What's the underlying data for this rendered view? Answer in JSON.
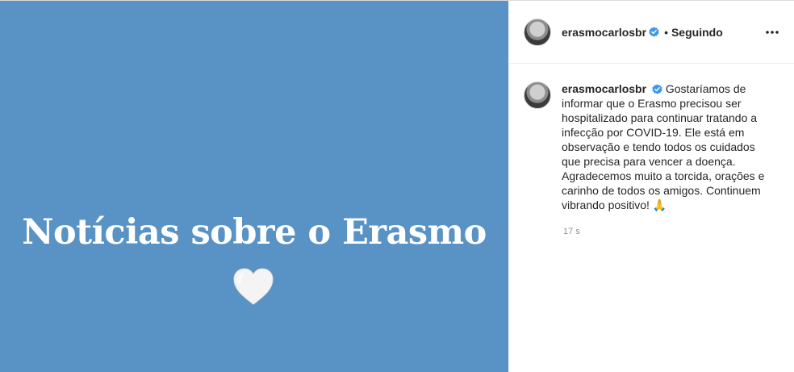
{
  "media": {
    "title": "Notícias sobre o Erasmo",
    "heart_icon": "white-heart-icon",
    "background_color": "#5993c6"
  },
  "header": {
    "username": "erasmocarlosbr",
    "separator": "•",
    "follow_status": "Seguindo",
    "verified_icon": "verified-badge-icon",
    "more_icon": "more-options-icon"
  },
  "caption": {
    "username": "erasmocarlosbr",
    "text": "Gostaríamos de informar que o Erasmo precisou ser hospitalizado para continuar tratando a infecção por COVID-19. Ele está em observação e tendo todos os cuidados que precisa para vencer a doença. Agradecemos muito a torcida, orações e carinho de todos os amigos. Continuem vibrando positivo!",
    "emoji": "🙏",
    "timestamp": "17 s"
  },
  "colors": {
    "verified": "#3897f0",
    "text": "#262626",
    "muted": "#8e8e8e"
  }
}
